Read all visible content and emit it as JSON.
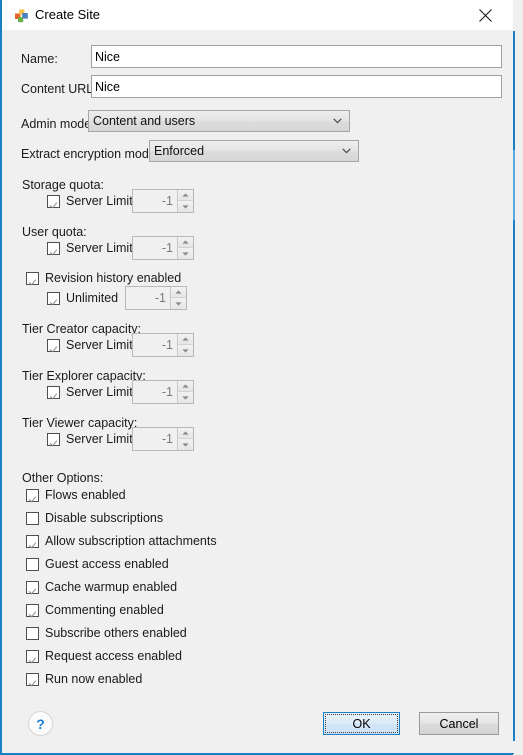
{
  "window": {
    "title": "Create Site",
    "icon": "tableau-site-icon",
    "close_icon": "close-icon",
    "border_color": "#1b7fc4"
  },
  "fields": {
    "name": {
      "label": "Name:",
      "value": "Nice",
      "placeholder": ""
    },
    "content_url": {
      "label": "Content URL",
      "value": "Nice",
      "placeholder": ""
    },
    "admin_mode": {
      "label": "Admin mode:",
      "value": "Content and users"
    },
    "extract_encryption_mode": {
      "label": "Extract encryption mode:",
      "value": "Enforced"
    }
  },
  "quotas": [
    {
      "group_label": "Storage quota:",
      "checkbox_label": "Server Limit",
      "checked": true,
      "spinner_value": "-1",
      "spinner_enabled": false
    },
    {
      "group_label": "User quota:",
      "checkbox_label": "Server Limit",
      "checked": true,
      "spinner_value": "-1",
      "spinner_enabled": false
    }
  ],
  "revision_history": {
    "label": "Revision history enabled",
    "checked": true,
    "child": {
      "label": "Unlimited",
      "checked": true,
      "spinner_value": "-1",
      "spinner_enabled": false
    }
  },
  "tiers": [
    {
      "group_label": "Tier Creator capacity:",
      "checkbox_label": "Server Limit",
      "checked": true,
      "spinner_value": "-1",
      "spinner_enabled": false
    },
    {
      "group_label": "Tier Explorer capacity:",
      "checkbox_label": "Server Limit",
      "checked": true,
      "spinner_value": "-1",
      "spinner_enabled": false
    },
    {
      "group_label": "Tier Viewer capacity:",
      "checkbox_label": "Server Limit",
      "checked": true,
      "spinner_value": "-1",
      "spinner_enabled": false
    }
  ],
  "other_options": {
    "heading": "Other Options:",
    "items": [
      {
        "label": "Flows enabled",
        "checked": true
      },
      {
        "label": "Disable subscriptions",
        "checked": false
      },
      {
        "label": "Allow subscription attachments",
        "checked": true
      },
      {
        "label": "Guest access enabled",
        "checked": false
      },
      {
        "label": "Cache warmup enabled",
        "checked": true
      },
      {
        "label": "Commenting enabled",
        "checked": true
      },
      {
        "label": "Subscribe others enabled",
        "checked": false
      },
      {
        "label": "Request access enabled",
        "checked": true
      },
      {
        "label": "Run now enabled",
        "checked": true
      }
    ]
  },
  "footer": {
    "help_icon": "question-mark-icon",
    "help_label": "?",
    "ok_label": "OK",
    "cancel_label": "Cancel",
    "focused_button": "OK"
  }
}
